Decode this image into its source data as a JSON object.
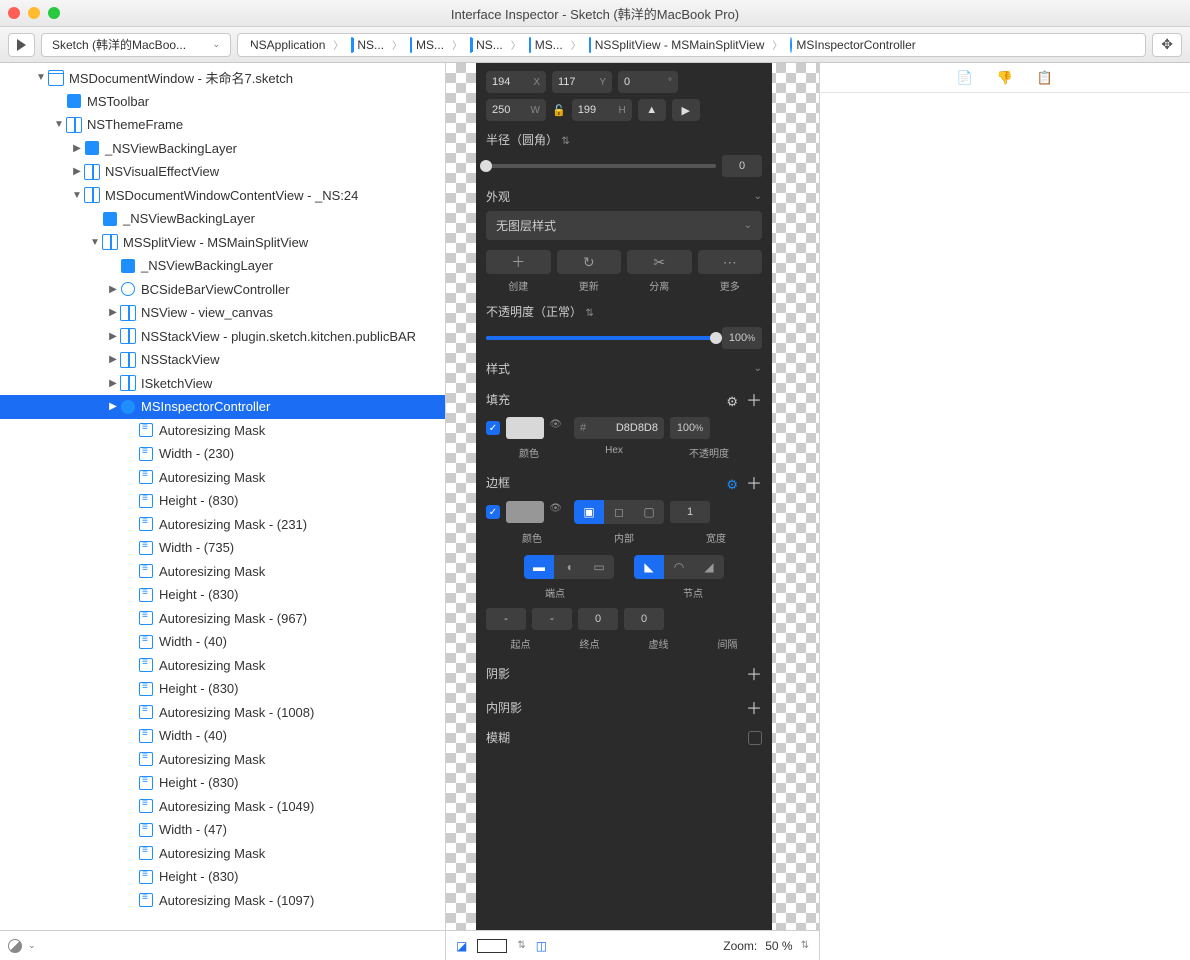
{
  "window": {
    "title": "Interface Inspector - Sketch (韩洋的MacBook Pro)"
  },
  "toolbar": {
    "app_selector": "Sketch (韩洋的MacBoo...",
    "breadcrumbs": [
      {
        "icon": "app",
        "label": "NSApplication"
      },
      {
        "icon": "split",
        "label": "NS..."
      },
      {
        "icon": "win",
        "label": "MS..."
      },
      {
        "icon": "split",
        "label": "NS..."
      },
      {
        "icon": "split",
        "label": "MS..."
      },
      {
        "icon": "split",
        "label": "NSSplitView - MSMainSplitView"
      },
      {
        "icon": "vc",
        "label": "MSInspectorController"
      }
    ]
  },
  "tree": [
    {
      "indent": 1,
      "disclosure": "down",
      "icon": "win",
      "label": "MSDocumentWindow - 未命名7.sketch"
    },
    {
      "indent": 2,
      "disclosure": "",
      "icon": "cube",
      "label": "MSToolbar"
    },
    {
      "indent": 2,
      "disclosure": "down",
      "icon": "split",
      "label": "NSThemeFrame"
    },
    {
      "indent": 3,
      "disclosure": "right",
      "icon": "cube",
      "label": "_NSViewBackingLayer"
    },
    {
      "indent": 3,
      "disclosure": "right",
      "icon": "split",
      "label": "NSVisualEffectView"
    },
    {
      "indent": 3,
      "disclosure": "down",
      "icon": "split",
      "label": "MSDocumentWindowContentView - _NS:24"
    },
    {
      "indent": 4,
      "disclosure": "",
      "icon": "cube",
      "label": "_NSViewBackingLayer"
    },
    {
      "indent": 4,
      "disclosure": "down",
      "icon": "split",
      "label": "MSSplitView - MSMainSplitView"
    },
    {
      "indent": 5,
      "disclosure": "",
      "icon": "cube",
      "label": "_NSViewBackingLayer"
    },
    {
      "indent": 5,
      "disclosure": "right",
      "icon": "vc",
      "label": "BCSideBarViewController"
    },
    {
      "indent": 5,
      "disclosure": "right",
      "icon": "split",
      "label": "NSView - view_canvas"
    },
    {
      "indent": 5,
      "disclosure": "right",
      "icon": "split",
      "label": "NSStackView - plugin.sketch.kitchen.publicBAR"
    },
    {
      "indent": 5,
      "disclosure": "right",
      "icon": "split",
      "label": "NSStackView"
    },
    {
      "indent": 5,
      "disclosure": "right",
      "icon": "split",
      "label": "ISketchView"
    },
    {
      "indent": 5,
      "disclosure": "right",
      "icon": "vc-solid",
      "label": "MSInspectorController",
      "selected": true
    },
    {
      "indent": 6,
      "disclosure": "",
      "icon": "attr",
      "label": "Autoresizing Mask"
    },
    {
      "indent": 6,
      "disclosure": "",
      "icon": "attr",
      "label": "Width - (230)"
    },
    {
      "indent": 6,
      "disclosure": "",
      "icon": "attr",
      "label": "Autoresizing Mask"
    },
    {
      "indent": 6,
      "disclosure": "",
      "icon": "attr",
      "label": "Height - (830)"
    },
    {
      "indent": 6,
      "disclosure": "",
      "icon": "attr",
      "label": "Autoresizing Mask - (231)"
    },
    {
      "indent": 6,
      "disclosure": "",
      "icon": "attr",
      "label": "Width - (735)"
    },
    {
      "indent": 6,
      "disclosure": "",
      "icon": "attr",
      "label": "Autoresizing Mask"
    },
    {
      "indent": 6,
      "disclosure": "",
      "icon": "attr",
      "label": "Height - (830)"
    },
    {
      "indent": 6,
      "disclosure": "",
      "icon": "attr",
      "label": "Autoresizing Mask - (967)"
    },
    {
      "indent": 6,
      "disclosure": "",
      "icon": "attr",
      "label": "Width - (40)"
    },
    {
      "indent": 6,
      "disclosure": "",
      "icon": "attr",
      "label": "Autoresizing Mask"
    },
    {
      "indent": 6,
      "disclosure": "",
      "icon": "attr",
      "label": "Height - (830)"
    },
    {
      "indent": 6,
      "disclosure": "",
      "icon": "attr",
      "label": "Autoresizing Mask - (1008)"
    },
    {
      "indent": 6,
      "disclosure": "",
      "icon": "attr",
      "label": "Width - (40)"
    },
    {
      "indent": 6,
      "disclosure": "",
      "icon": "attr",
      "label": "Autoresizing Mask"
    },
    {
      "indent": 6,
      "disclosure": "",
      "icon": "attr",
      "label": "Height - (830)"
    },
    {
      "indent": 6,
      "disclosure": "",
      "icon": "attr",
      "label": "Autoresizing Mask - (1049)"
    },
    {
      "indent": 6,
      "disclosure": "",
      "icon": "attr",
      "label": "Width - (47)"
    },
    {
      "indent": 6,
      "disclosure": "",
      "icon": "attr",
      "label": "Autoresizing Mask"
    },
    {
      "indent": 6,
      "disclosure": "",
      "icon": "attr",
      "label": "Height - (830)"
    },
    {
      "indent": 6,
      "disclosure": "",
      "icon": "attr",
      "label": "Autoresizing Mask - (1097)"
    }
  ],
  "inspector": {
    "position": {
      "x": "194",
      "y": "117",
      "rotation": "0"
    },
    "size": {
      "w": "250",
      "h": "199"
    },
    "radius_label": "半径（圆角）",
    "radius_value": "0",
    "appearance": {
      "title": "外观",
      "style_select": "无图层样式",
      "btn_create": "创建",
      "btn_update": "更新",
      "btn_detach": "分离",
      "btn_more": "更多"
    },
    "opacity": {
      "label": "不透明度（正常）",
      "value": "100",
      "unit": "%"
    },
    "style_title": "样式",
    "fill": {
      "title": "填充",
      "hex": "D8D8D8",
      "opacity": "100",
      "opacity_unit": "%",
      "label_color": "颜色",
      "label_hex": "Hex",
      "label_opacity": "不透明度"
    },
    "border": {
      "title": "边框",
      "width": "1",
      "label_color": "颜色",
      "label_position": "内部",
      "label_width": "宽度",
      "endpoints_label": "端点",
      "joints_label": "节点",
      "dash_start": "-",
      "dash_end": "-",
      "dash_gap1": "0",
      "dash_gap2": "0",
      "label_start": "起点",
      "label_end": "终点",
      "label_dash": "虚线",
      "label_gap": "间隔"
    },
    "shadow": {
      "title": "阴影"
    },
    "inner_shadow": {
      "title": "内阴影"
    },
    "blur": {
      "title": "模糊"
    }
  },
  "footer": {
    "zoom_label": "Zoom:",
    "zoom_value": "50 %"
  }
}
